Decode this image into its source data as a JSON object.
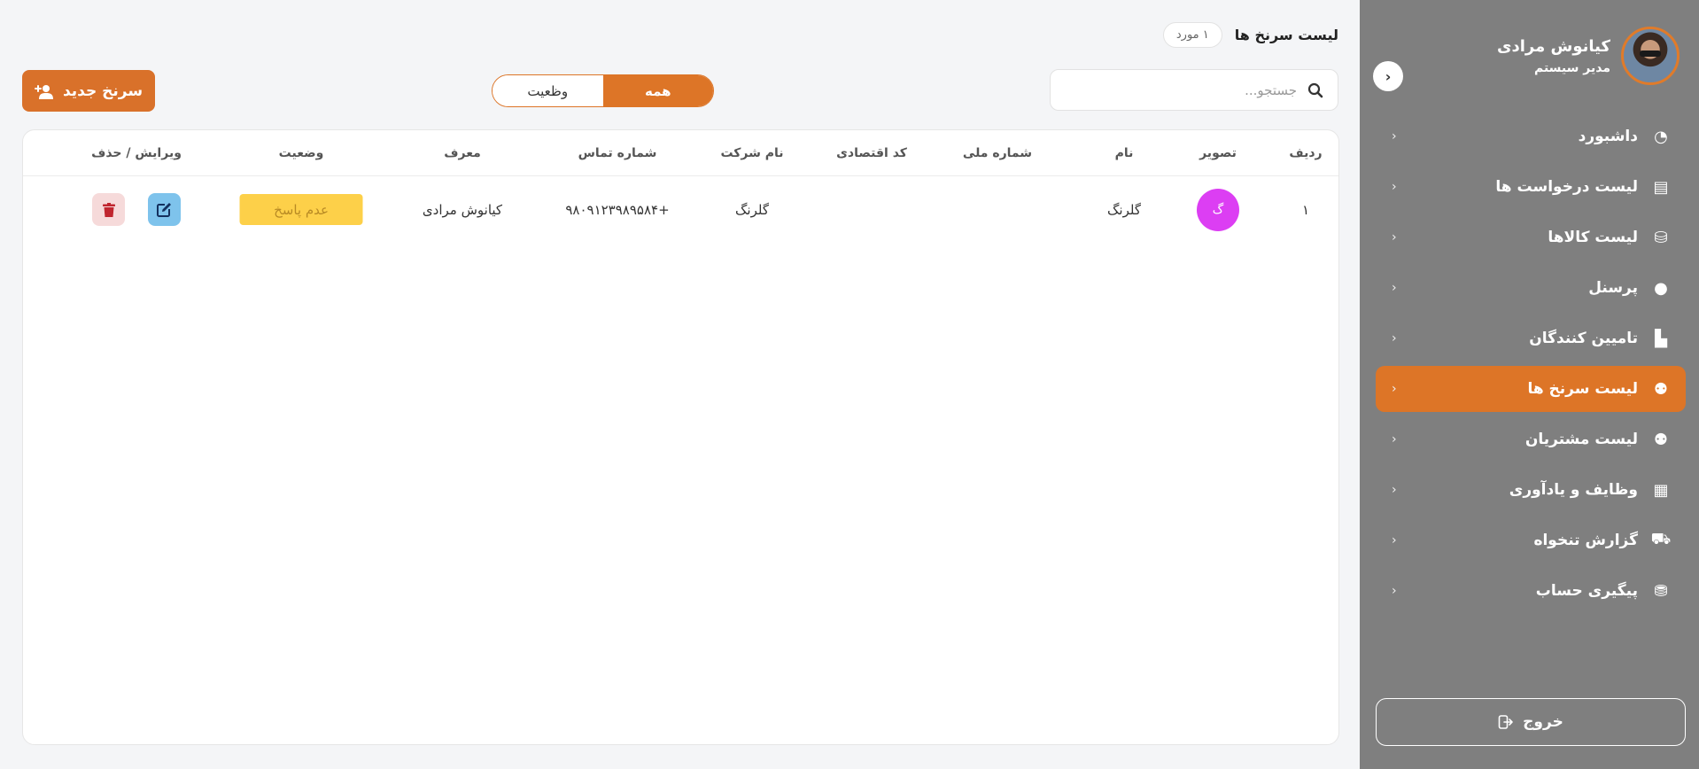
{
  "sidebar": {
    "profile": {
      "name": "کیانوش مرادی",
      "role": "مدیر سیستم"
    },
    "collapse_icon": "‹",
    "items": [
      {
        "label": "داشبورد",
        "icon": "◔",
        "icon_name": "dashboard-icon",
        "active": false
      },
      {
        "label": "لیست درخواست ها",
        "icon": "▤",
        "icon_name": "file-chart-icon",
        "active": false
      },
      {
        "label": "لیست کالاها",
        "icon": "⛁",
        "icon_name": "hand-holding-icon",
        "active": false
      },
      {
        "label": "پرسنل",
        "icon": "●",
        "icon_name": "user-icon",
        "active": false
      },
      {
        "label": "تامیین کنندگان",
        "icon": "▙",
        "icon_name": "industry-icon",
        "active": false
      },
      {
        "label": "لیست سرنخ ها",
        "icon": "⚉",
        "icon_name": "users-icon",
        "active": true
      },
      {
        "label": "لیست مشتریان",
        "icon": "⚉",
        "icon_name": "users-icon",
        "active": false
      },
      {
        "label": "وظایف و یادآوری",
        "icon": "▦",
        "icon_name": "calendar-icon",
        "active": false
      },
      {
        "label": "گزارش تنخواه",
        "icon": "⛟",
        "icon_name": "cart-icon",
        "active": false
      },
      {
        "label": "پیگیری حساب",
        "icon": "⛃",
        "icon_name": "money-bag-icon",
        "active": false
      }
    ],
    "chevron": "‹",
    "logout_label": "خروج",
    "accent": "#dd7527"
  },
  "main": {
    "title": "لیست سرنخ ها",
    "count_badge": "۱ مورد",
    "search_placeholder": "جستجو...",
    "filters": [
      {
        "label": "همه",
        "active": true
      },
      {
        "label": "وظعیت",
        "active": false
      }
    ],
    "new_button_label": "سرنخ جدید",
    "table": {
      "headers": [
        "ردیف",
        "تصویر",
        "نام",
        "شماره ملی",
        "کد اقتصادی",
        "نام شرکت",
        "شماره تماس",
        "معرف",
        "وضعیت",
        "ویرایش / حذف"
      ],
      "rows": [
        {
          "index": "۱",
          "image_letter": "گ",
          "name": "گلرنگ",
          "national_id": "",
          "economic_code": "",
          "company": "گلرنگ",
          "phone": "+۹۸۰۹۱۲۳۹۸۹۵۸۴",
          "referrer": "کیانوش مرادی",
          "status": "عدم پاسخ"
        }
      ]
    }
  }
}
